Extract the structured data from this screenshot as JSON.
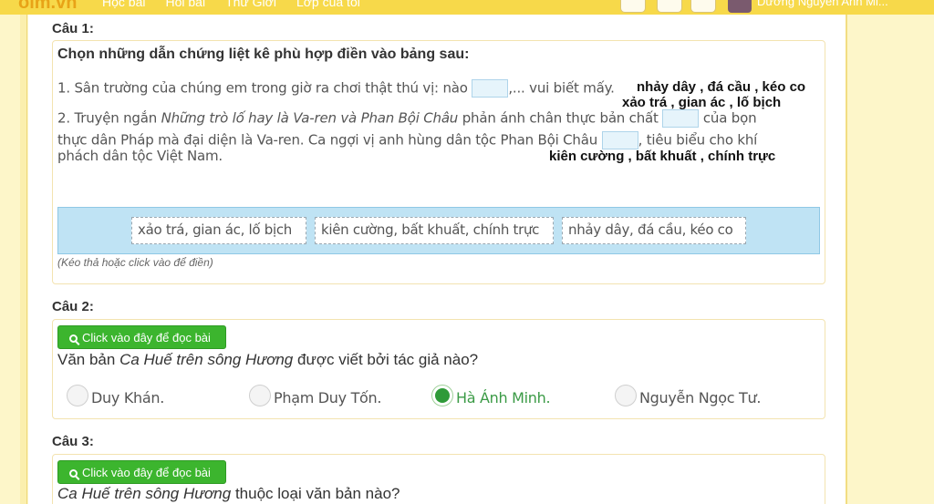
{
  "header": {
    "logo": "olm.vn",
    "nav": [
      "Học bài",
      "Hỏi bài",
      "Thử Giới",
      "Lớp của tôi"
    ],
    "icons": [
      "trophy-icon",
      "book-icon",
      "globe-icon"
    ],
    "username": "Dương Nguyễn Anh Mi..."
  },
  "q1": {
    "heading": "Câu 1:",
    "title": "Chọn những dẫn chứng liệt kê phù hợp điền vào bảng sau:",
    "line1_a": "1. Sân trường của chúng em trong giờ ra chơi thật thú vị: nào",
    "line1_b": ",... vui biết mấy.",
    "line2_a": "2. Truyện ngắn ",
    "line2_italic": "Những trò lố hay là Va-ren và Phan Bội Châu",
    "line2_b": " phản ánh chân thực bản chất",
    "line2_c": " của bọn",
    "line3_a": "thực dân Pháp mà đại diện là Va-ren. Ca ngợi vị anh hùng dân tộc Phan Bội Châu",
    "line3_b": ", tiêu biểu cho khí",
    "line4": "phách dân tộc Việt Nam.",
    "annotations": [
      "nhảy dây , đá cầu , kéo co",
      "xảo trá , gian ác , lố bịch",
      "kiên cường , bất khuất , chính trực"
    ],
    "chips": [
      "xảo trá, gian ác, lố bịch",
      "kiên cường, bất khuất, chính trực",
      "nhảy dây, đá cầu, kéo co"
    ],
    "hint": "(Kéo thả hoặc click vào để điền)"
  },
  "q2": {
    "heading": "Câu 2:",
    "read_button": "Click vào đây để đọc bài",
    "question_a": "Văn bản ",
    "question_italic": "Ca Huế trên sông Hương",
    "question_b": " được viết bởi tác giả nào?",
    "options": [
      "Duy Khán.",
      "Phạm Duy Tốn.",
      "Hà Ánh Minh.",
      "Nguyễn Ngọc Tư."
    ],
    "selected_index": 2
  },
  "q3": {
    "heading": "Câu 3:",
    "read_button": "Click vào đây để đọc bài",
    "question_italic": "Ca Huế trên sông Hương",
    "question_b": " thuộc loại văn bản nào?"
  },
  "colors": {
    "header_bg": "#f7d94a",
    "page_bg": "#fdf6c9",
    "button_green": "#3cb52e",
    "dropzone_blue": "#bfe3f4",
    "selected_green": "#2e9a38"
  }
}
